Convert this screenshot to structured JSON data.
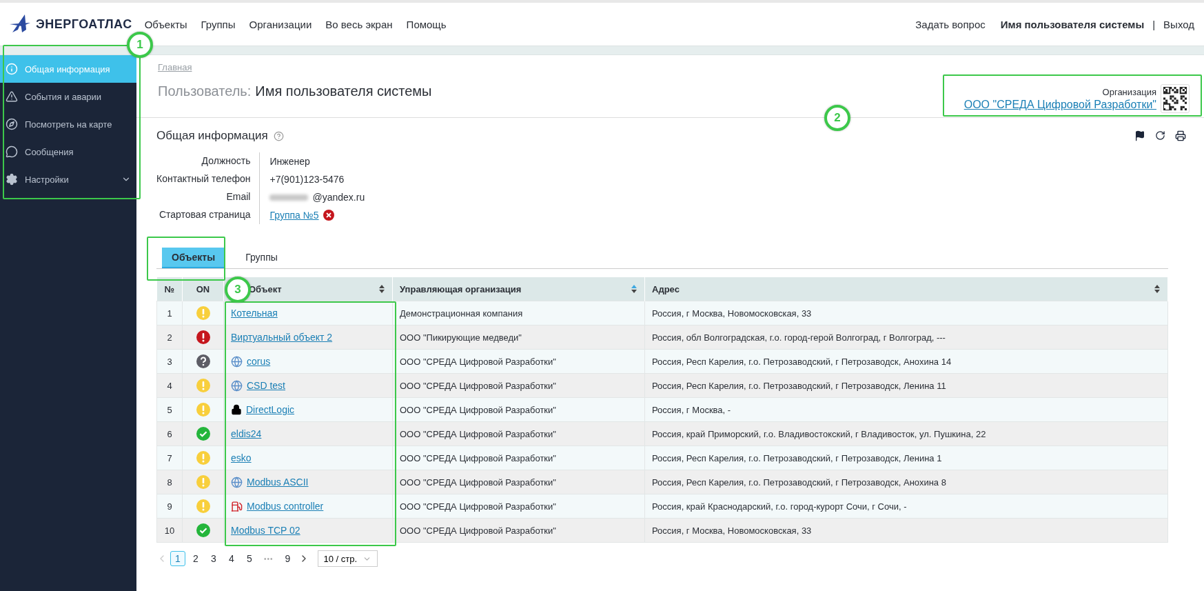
{
  "brand": {
    "name": "ЭНЕРГОАТЛАС"
  },
  "nav": [
    "Объекты",
    "Группы",
    "Организации",
    "Во весь экран",
    "Помощь"
  ],
  "header_right": {
    "ask": "Задать вопрос",
    "user": "Имя пользователя системы",
    "separator": "|",
    "logout": "Выход"
  },
  "sidebar": {
    "items": [
      {
        "label": "Общая информация",
        "kind": "info",
        "selected": true,
        "expandable": false
      },
      {
        "label": "События и аварии",
        "kind": "warning",
        "selected": false,
        "expandable": false
      },
      {
        "label": "Посмотреть на карте",
        "kind": "compass",
        "selected": false,
        "expandable": false
      },
      {
        "label": "Сообщения",
        "kind": "message",
        "selected": false,
        "expandable": false
      },
      {
        "label": "Настройки",
        "kind": "gear",
        "selected": false,
        "expandable": true
      }
    ]
  },
  "breadcrumb": "Главная",
  "page_title": {
    "prefix": "Пользователь:",
    "name": "Имя пользователя системы"
  },
  "organization": {
    "label": "Организация",
    "name": "ООО \"СРЕДА Цифровой Разработки\""
  },
  "section": {
    "title": "Общая информация"
  },
  "info": [
    {
      "label": "Должность",
      "value": "Инженер",
      "kind": "text",
      "redacted": false
    },
    {
      "label": "Контактный телефон",
      "value": "+7(901)123-5476",
      "kind": "text",
      "redacted": false
    },
    {
      "label": "Email",
      "value": "@yandex.ru",
      "kind": "text",
      "redacted": true
    },
    {
      "label": "Стартовая страница",
      "value": "Группа №5",
      "kind": "link",
      "redacted": false
    }
  ],
  "tabs": [
    {
      "label": "Объекты",
      "selected": true
    },
    {
      "label": "Группы",
      "selected": false
    }
  ],
  "table": {
    "columns": [
      {
        "label": "№",
        "kind": "plain"
      },
      {
        "label": "ON",
        "kind": "plain"
      },
      {
        "label": "Объект",
        "kind": "sortable"
      },
      {
        "label": "Управляющая организация",
        "kind": "sorted_asc"
      },
      {
        "label": "Адрес",
        "kind": "sortable"
      }
    ],
    "rows": [
      {
        "n": "1",
        "on": {
          "kind": "warning"
        },
        "object": {
          "kind": "plain",
          "label": "Котельная"
        },
        "org": "Демонстрационная компания",
        "address": "Россия, г Москва, Новомосковская, 33"
      },
      {
        "n": "2",
        "on": {
          "kind": "error"
        },
        "object": {
          "kind": "plain",
          "label": "Виртуальный объект 2"
        },
        "org": "ООО \"Пикирующие медведи\"",
        "address": "Россия, обл Волгоградская, г.о. город-герой Волгоград, г Волгоград, ---"
      },
      {
        "n": "3",
        "on": {
          "kind": "unknown"
        },
        "object": {
          "kind": "globe",
          "label": "corus"
        },
        "org": "ООО \"СРЕДА Цифровой Разработки\"",
        "address": "Россия, Респ Карелия, г.о. Петрозаводский, г Петрозаводск, Анохина 14"
      },
      {
        "n": "4",
        "on": {
          "kind": "warning"
        },
        "object": {
          "kind": "globe",
          "label": "CSD test"
        },
        "org": "ООО \"СРЕДА Цифровой Разработки\"",
        "address": "Россия, Респ Карелия, г.о. Петрозаводский, г Петрозаводск, Ленина 11"
      },
      {
        "n": "5",
        "on": {
          "kind": "warning"
        },
        "object": {
          "kind": "lock",
          "label": "DirectLogic"
        },
        "org": "ООО \"СРЕДА Цифровой Разработки\"",
        "address": "Россия, г Москва, -"
      },
      {
        "n": "6",
        "on": {
          "kind": "ok"
        },
        "object": {
          "kind": "plain",
          "label": "eldis24"
        },
        "org": "ООО \"СРЕДА Цифровой Разработки\"",
        "address": "Россия, край Приморский, г.о. Владивостокский, г Владивосток, ул. Пушкина, 22"
      },
      {
        "n": "7",
        "on": {
          "kind": "warning"
        },
        "object": {
          "kind": "plain",
          "label": "esko"
        },
        "org": "ООО \"СРЕДА Цифровой Разработки\"",
        "address": "Россия, Респ Карелия, г.о. Петрозаводский, г Петрозаводск, Ленина 1"
      },
      {
        "n": "8",
        "on": {
          "kind": "warning"
        },
        "object": {
          "kind": "globe",
          "label": "Modbus ASCII"
        },
        "org": "ООО \"СРЕДА Цифровой Разработки\"",
        "address": "Россия, Респ Карелия, г.о. Петрозаводский, г Петрозаводск, Анохина 8"
      },
      {
        "n": "9",
        "on": {
          "kind": "warning"
        },
        "object": {
          "kind": "fuel",
          "label": "Modbus controller"
        },
        "org": "ООО \"СРЕДА Цифровой Разработки\"",
        "address": "Россия, край Краснодарский, г.о. город-курорт Сочи, г Сочи, -"
      },
      {
        "n": "10",
        "on": {
          "kind": "ok"
        },
        "object": {
          "kind": "plain",
          "label": "Modbus TCP 02"
        },
        "org": "ООО \"СРЕДА Цифровой Разработки\"",
        "address": "Россия, г Москва, Новомосковская, 33"
      }
    ]
  },
  "pagination": {
    "prev_disabled": true,
    "next_disabled": false,
    "pages": [
      {
        "label": "1",
        "kind": "page",
        "selected": true
      },
      {
        "label": "2",
        "kind": "page",
        "selected": false
      },
      {
        "label": "3",
        "kind": "page",
        "selected": false
      },
      {
        "label": "4",
        "kind": "page",
        "selected": false
      },
      {
        "label": "5",
        "kind": "page",
        "selected": false
      },
      {
        "label": "•••",
        "kind": "ellipsis"
      },
      {
        "label": "9",
        "kind": "page",
        "selected": false
      }
    ],
    "page_size": "10 / стр."
  },
  "callouts": [
    "1",
    "2",
    "3"
  ]
}
